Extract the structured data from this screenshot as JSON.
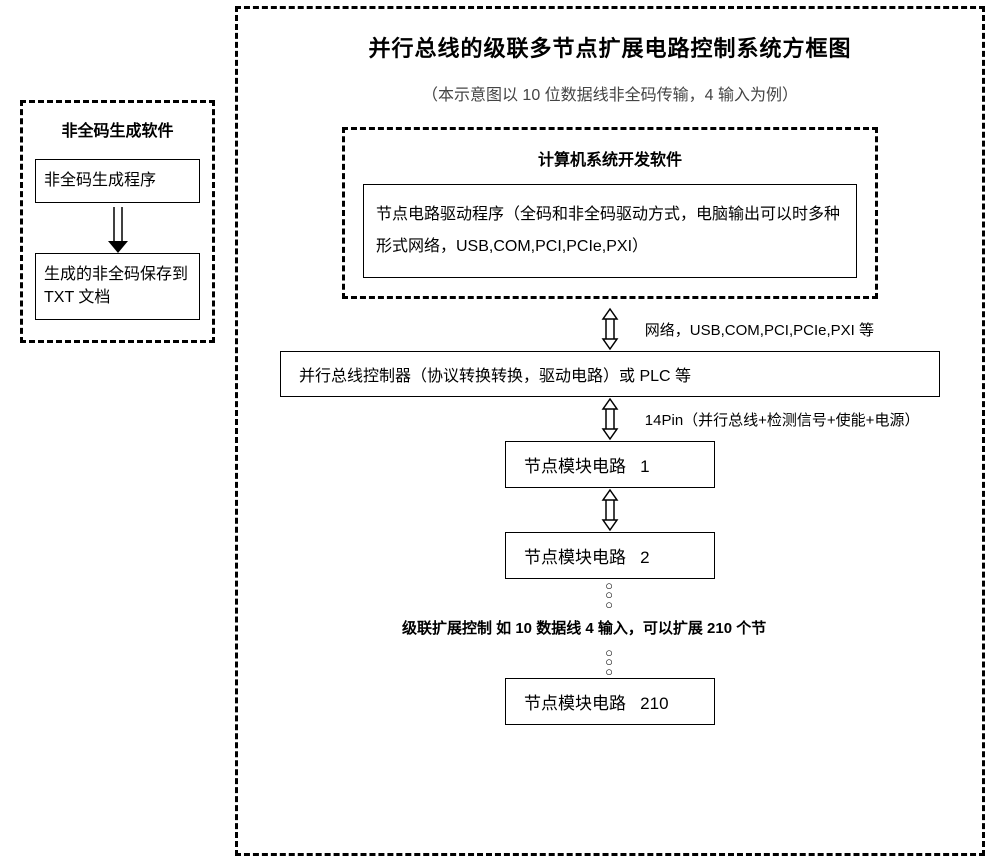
{
  "left": {
    "title": "非全码生成软件",
    "box1": "非全码生成程序",
    "box2": "生成的非全码保存到 TXT 文档"
  },
  "right": {
    "title": "并行总线的级联多节点扩展电路控制系统方框图",
    "subtitle": "（本示意图以 10 位数据线非全码传输，4 输入为例）",
    "dev_title": "计算机系统开发软件",
    "driver_text": "节点电路驱动程序（全码和非全码驱动方式，电脑输出可以时多种形式网络，USB,COM,PCI,PCIe,PXI）",
    "arrow1_label": "网络，USB,COM,PCI,PCIe,PXI 等",
    "controller": "并行总线控制器（协议转换转换，驱动电路）或 PLC 等",
    "arrow2_label": "14Pin（并行总线+检测信号+使能+电源）",
    "node1": "节点模块电路   1",
    "node2": "节点模块电路   2",
    "cascade_note": "级联扩展控制  如 10 数据线 4 输入，可以扩展 210 个节",
    "node210": "节点模块电路   210"
  }
}
